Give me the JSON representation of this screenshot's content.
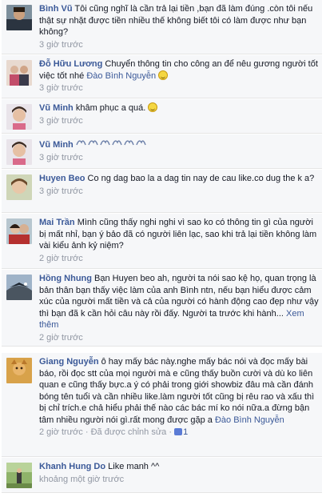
{
  "comments": [
    {
      "name": "Bình Vũ",
      "text": "Tôi cũng nghĩ là cần trả lại tiền ,bạn đã làm đúng .còn tôi nếu thật sự nhặt được tiền nhiều thế không biết tôi có làm được như bạn không?",
      "time": "3 giờ trước"
    },
    {
      "name": "Đỗ Hữu Lương",
      "text": "Chuyển thông tin cho công an để nêu gương người tốt việc tốt nhé",
      "mention": "Đào Bình Nguyễn",
      "time": "3 giờ trước"
    },
    {
      "name": "Vũ Minh",
      "text": "khâm phục a quá.",
      "time": "3 giờ trước"
    },
    {
      "name": "Vũ Minh",
      "text": "",
      "time": "3 giờ trước"
    },
    {
      "name": "Huyen Beo",
      "text": "Co ng dag bao la a dag tin nay de cau like.co dug the k a?",
      "time": "3 giờ trước"
    },
    {
      "name": "Mai Trần",
      "text": "Mình cũng thấy nghi nghi vì sao ko có thông tin gì của người bị mất nhỉ, bạn ý bảo đã có người liên lạc, sao khi trả lại tiền không làm vài kiểu ảnh kỷ niệm?",
      "time": "2 giờ trước"
    },
    {
      "name": "Hồng Nhung",
      "text": "Bạn Huyen beo ah, người ta nói sao kệ họ, quan trọng là bản thân bạn thấy việc làm của anh Bình ntn, nếu bạn hiểu được cảm xúc của người mất tiền và cả của người có hành động cao đẹp như vậy thì bạn đã k cần hỏi câu này rồi đấy. Người ta trước khi hành...",
      "see_more": "Xem thêm",
      "time": "2 giờ trước"
    },
    {
      "name": "Giang Nguyễn",
      "text": "ô hay mấy bác này.nghe mấy bác nói và đọc mấy bài báo, rồi đọc stt của mọi người mà e cũng thấy buồn cười và dù ko liên quan e cũng thấy bực.a ý có phải trong giới showbiz đâu mà cần đánh bóng tên tuổi và cần nhiều like.làm người tốt cũng bị rêu rao và xấu thì bị chỉ trích.e chả hiểu phải thế nào các bác mí ko nói nữa.a đừng bận tâm nhiều người nói gì.rất mong được gặp a",
      "mention": "Đào Bình Nguyễn",
      "time": "2 giờ trước",
      "edited": "Đã được chỉnh sửa",
      "likes": "1"
    },
    {
      "name": "Khanh Hung Do",
      "text": "Like manh ^^",
      "time": "khoảng một giờ trước"
    }
  ],
  "colors": {
    "name_link": "#3b5998",
    "meta_gray": "#9197a3",
    "row_bg": "#f6f7f9"
  }
}
